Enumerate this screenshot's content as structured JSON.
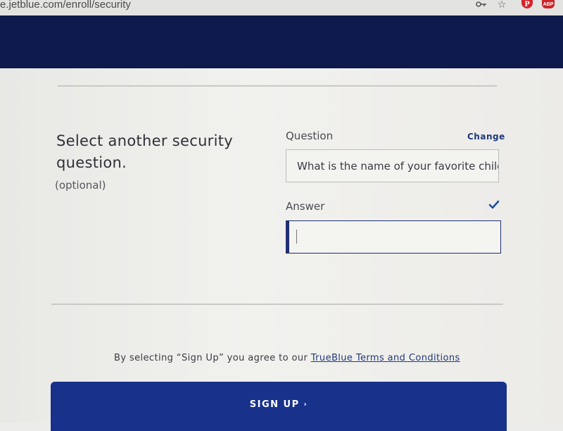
{
  "browser": {
    "url": "e.jetblue.com/enroll/security",
    "icons": [
      "key-icon",
      "star-icon",
      "pinterest-icon",
      "adblock-icon"
    ],
    "pinterest_glyph": "P",
    "adblock_glyph": "ABP"
  },
  "header": {
    "background_color": "#0d1a4b"
  },
  "security_question": {
    "title": "Select another security question.",
    "optional_note": "(optional)",
    "question_label": "Question",
    "change_link": "Change",
    "question_value": "What is the name of your favorite child",
    "answer_label": "Answer",
    "answer_value": "",
    "answer_valid_icon": "check-icon"
  },
  "terms": {
    "prefix": "By selecting “Sign Up” you agree to our ",
    "link_text": "TrueBlue Terms and Conditions"
  },
  "signup": {
    "label": "SIGN UP",
    "arrow": "›",
    "color": "#18318a"
  }
}
